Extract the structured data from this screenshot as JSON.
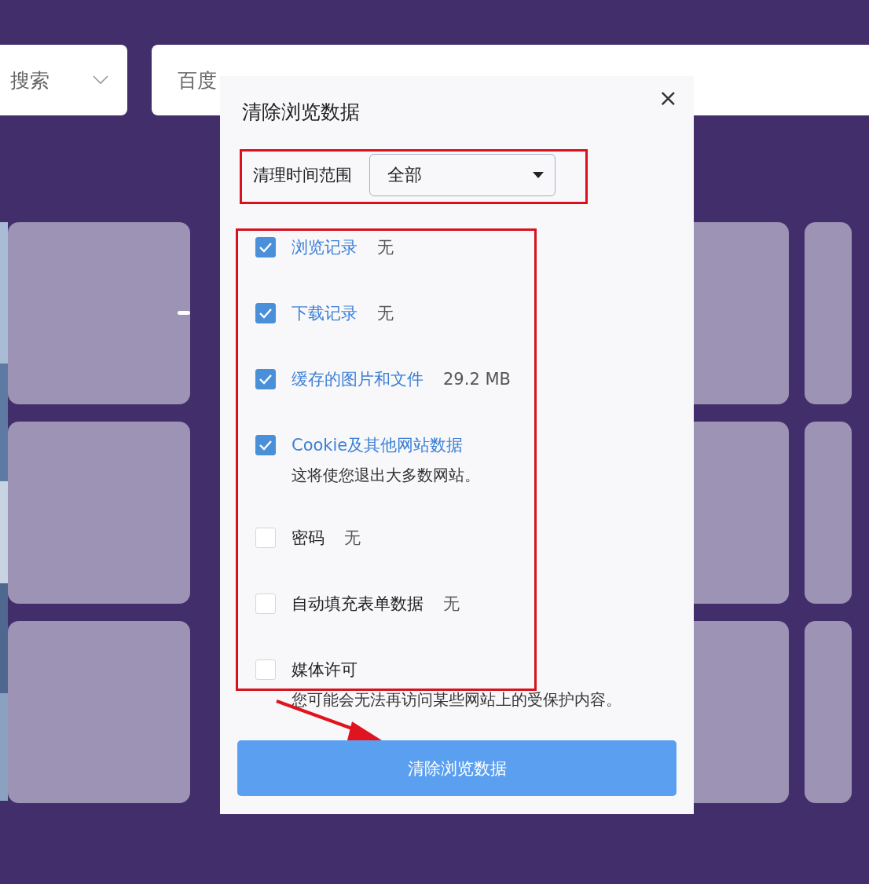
{
  "search_bar": {
    "engine_menu": "搜索",
    "engine": "百度"
  },
  "dialog": {
    "title": "清除浏览数据",
    "close": "×",
    "time_range": {
      "label": "清理时间范围",
      "value": "全部"
    },
    "items": [
      {
        "label": "浏览记录",
        "value": "无",
        "checked": true
      },
      {
        "label": "下载记录",
        "value": "无",
        "checked": true
      },
      {
        "label": "缓存的图片和文件",
        "value": "29.2 MB",
        "checked": true
      },
      {
        "label": "Cookie及其他网站数据",
        "description": "这将使您退出大多数网站。",
        "checked": true
      },
      {
        "label": "密码",
        "value": "无",
        "checked": false
      },
      {
        "label": "自动填充表单数据",
        "value": "无",
        "checked": false
      },
      {
        "label": "媒体许可",
        "description": "您可能会无法再访问某些网站上的受保护内容。",
        "checked": false
      }
    ],
    "button": "清除浏览数据"
  }
}
